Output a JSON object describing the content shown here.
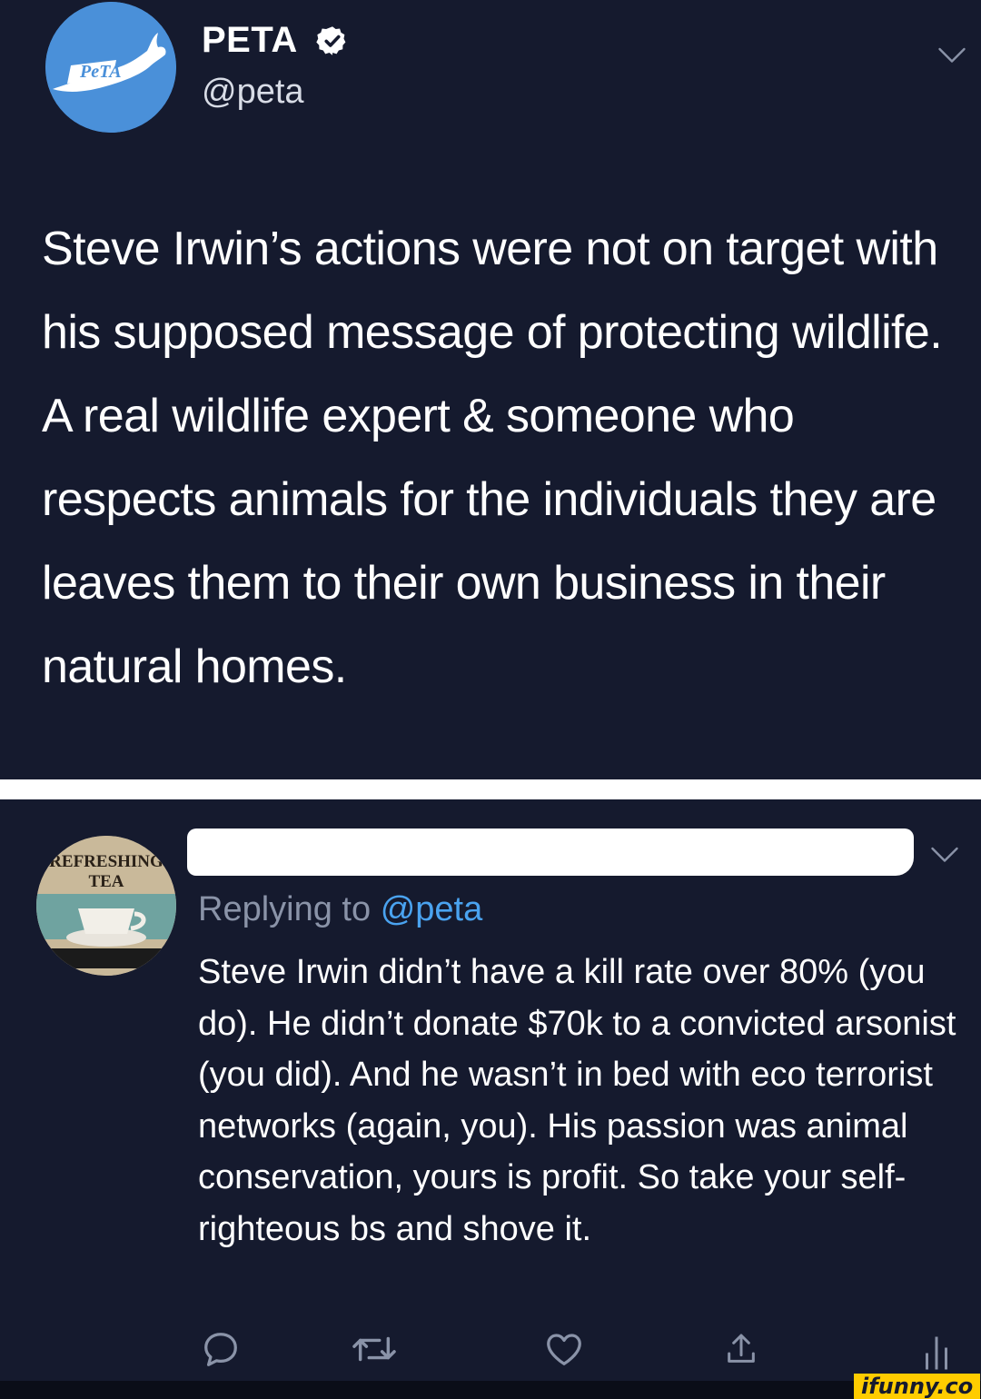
{
  "tweet_top": {
    "display_name": "PETA",
    "handle": "@peta",
    "avatar_logo_text": "PeTA",
    "text": "Steve Irwin’s actions were not on target with his supposed message of protecting wildlife. A real wildlife expert & someone who respects animals for the individuals they are leaves them to their own business in their natural homes.",
    "icons": [
      "verified-badge-icon",
      "chevron-down-icon"
    ]
  },
  "tweet_reply": {
    "avatar_text": "REFRESHING TEA",
    "replying_prefix": "Replying to",
    "replying_to": "@peta",
    "text": "Steve Irwin didn’t have a kill rate over 80% (you do). He didn’t donate $70k to a convicted arsonist (you did). And he wasn’t in bed with eco terrorist networks (again, you). His passion was animal conservation, yours is profit. So take your self-righteous bs and shove it.",
    "actions": [
      "reply-icon",
      "retweet-icon",
      "like-icon",
      "share-icon",
      "analytics-icon"
    ]
  },
  "watermark": "ifunny.co",
  "colors": {
    "background": "#151a2e",
    "text": "#ffffff",
    "muted": "#8a93a8",
    "link": "#4aa3f0",
    "peta_blue": "#4a90d9"
  }
}
